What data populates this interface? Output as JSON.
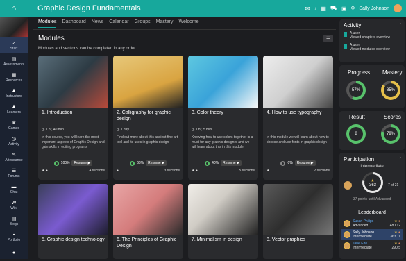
{
  "topbar": {
    "title": "Graphic Design Fundamentals",
    "user": "Sally Johnson"
  },
  "sidebar": {
    "items": [
      {
        "label": "Start",
        "icon": "rocket-icon",
        "glyph": "➚"
      },
      {
        "label": "Assessments",
        "icon": "assessment-icon",
        "glyph": "▤"
      },
      {
        "label": "Resources",
        "icon": "resources-icon",
        "glyph": "▦"
      },
      {
        "label": "Instructors",
        "icon": "instructor-icon",
        "glyph": "♟"
      },
      {
        "label": "Learners",
        "icon": "learners-icon",
        "glyph": "♟"
      },
      {
        "label": "Games",
        "icon": "trophy-icon",
        "glyph": "♛"
      },
      {
        "label": "Activity",
        "icon": "clock-icon",
        "glyph": "◷"
      },
      {
        "label": "Attendance",
        "icon": "attendance-icon",
        "glyph": "✎"
      },
      {
        "label": "Forums",
        "icon": "forum-icon",
        "glyph": "☰"
      },
      {
        "label": "Chat",
        "icon": "chat-icon",
        "glyph": "▬"
      },
      {
        "label": "Wiki",
        "icon": "wiki-icon",
        "glyph": "W"
      },
      {
        "label": "Blogs",
        "icon": "blog-icon",
        "glyph": "▤"
      },
      {
        "label": "Portfolio",
        "icon": "portfolio-icon",
        "glyph": "▪"
      },
      {
        "label": "",
        "icon": "info-icon",
        "glyph": "●"
      }
    ]
  },
  "tabs": [
    "Modules",
    "Dashboard",
    "News",
    "Calendar",
    "Groups",
    "Mastery",
    "Welcome"
  ],
  "main": {
    "title": "Modules",
    "subtitle": "Modules and sections can be completed in any order."
  },
  "cards": [
    {
      "title": "1. Introduction",
      "meta": "1 hr, 40 min",
      "desc": "In this course, you will learn the most important aspects of Graphic Design and gain skills in editing programs",
      "progress": "100%",
      "resume": "Resume",
      "sections": "4 sections"
    },
    {
      "title": "2. Calligraphy for graphic design",
      "meta": "1 day",
      "desc": "Find out more about this ancient fine art tool and its uses in graphic design",
      "progress": "66%",
      "resume": "Resume",
      "sections": "3 sections"
    },
    {
      "title": "3. Color theory",
      "meta": "1 hr, 5 min",
      "desc": "Knowing how to use colors together is a must for any graphic designer and we will learn about this in this module",
      "progress": "40%",
      "resume": "Resume",
      "sections": "5 sections"
    },
    {
      "title": "4. How to use typography",
      "meta": "",
      "desc": "In this module we will learn about how to choose and use fonts in graphic design",
      "progress": "0%",
      "resume": "Resume",
      "sections": "2 sections"
    }
  ],
  "cards2": [
    {
      "title": "5. Graphic design technology"
    },
    {
      "title": "6. The Principles of Graphic Design"
    },
    {
      "title": "7. Minimalism in design"
    },
    {
      "title": "8. Vector graphics"
    }
  ],
  "activity": {
    "title": "Activity",
    "items": [
      {
        "user": "A user",
        "text": "Viewed chapters overview"
      },
      {
        "user": "A user",
        "text": "Viewed modules overview"
      }
    ]
  },
  "progress": {
    "label": "Progress",
    "value": "57%",
    "value_num": 57
  },
  "mastery": {
    "label": "Mastery",
    "value": "85%",
    "value_num": 85
  },
  "result": {
    "label": "Result",
    "value": "8"
  },
  "scores": {
    "label": "Scores",
    "value": "79%",
    "value_num": 79
  },
  "participation": {
    "title": "Participation",
    "level": "Intermediate",
    "points": "363",
    "rank": "7 of 21",
    "until": "37 points until Advanced"
  },
  "leaderboard": {
    "title": "Leaderboard",
    "rows": [
      {
        "name": "Susan Philips",
        "level": "Advanced",
        "pts": "480",
        "n": "12"
      },
      {
        "name": "Sally Johnson",
        "level": "Intermediate",
        "pts": "363",
        "n": "11"
      },
      {
        "name": "Jane Eire",
        "level": "Intermediate",
        "pts": "290",
        "n": "5"
      }
    ]
  },
  "colors": {
    "accent": "#17a89c",
    "green": "#58c26b",
    "yellow": "#e6c04a"
  }
}
